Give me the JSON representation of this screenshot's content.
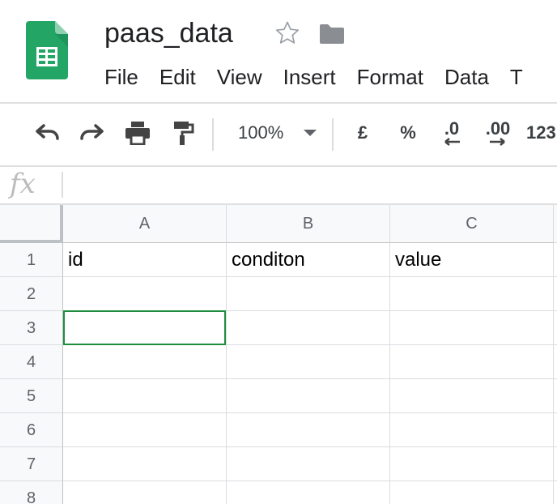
{
  "doc": {
    "title": "paas_data"
  },
  "menu": [
    "File",
    "Edit",
    "View",
    "Insert",
    "Format",
    "Data",
    "T"
  ],
  "toolbar": {
    "zoom": "100%",
    "currency": "£",
    "percent": "%",
    "decrease_decimal": ".0",
    "increase_decimal": ".00",
    "more_formats": "123"
  },
  "formula_bar": {
    "fx_label": "fx",
    "value": ""
  },
  "sheet": {
    "columns": [
      "A",
      "B",
      "C"
    ],
    "rows": [
      "1",
      "2",
      "3",
      "4",
      "5",
      "6",
      "7",
      "8"
    ],
    "cells": [
      [
        "id",
        "conditon",
        "value"
      ],
      [
        "",
        "",
        ""
      ],
      [
        "",
        "",
        ""
      ],
      [
        "",
        "",
        ""
      ],
      [
        "",
        "",
        ""
      ],
      [
        "",
        "",
        ""
      ],
      [
        "",
        "",
        ""
      ],
      [
        "",
        "",
        ""
      ]
    ],
    "selected_cell": "A3",
    "selection_color": "#1e8e3e"
  },
  "colors": {
    "sheets_green": "#23a566",
    "grid_line": "#dadce0",
    "header_bg": "#f8f9fa"
  }
}
